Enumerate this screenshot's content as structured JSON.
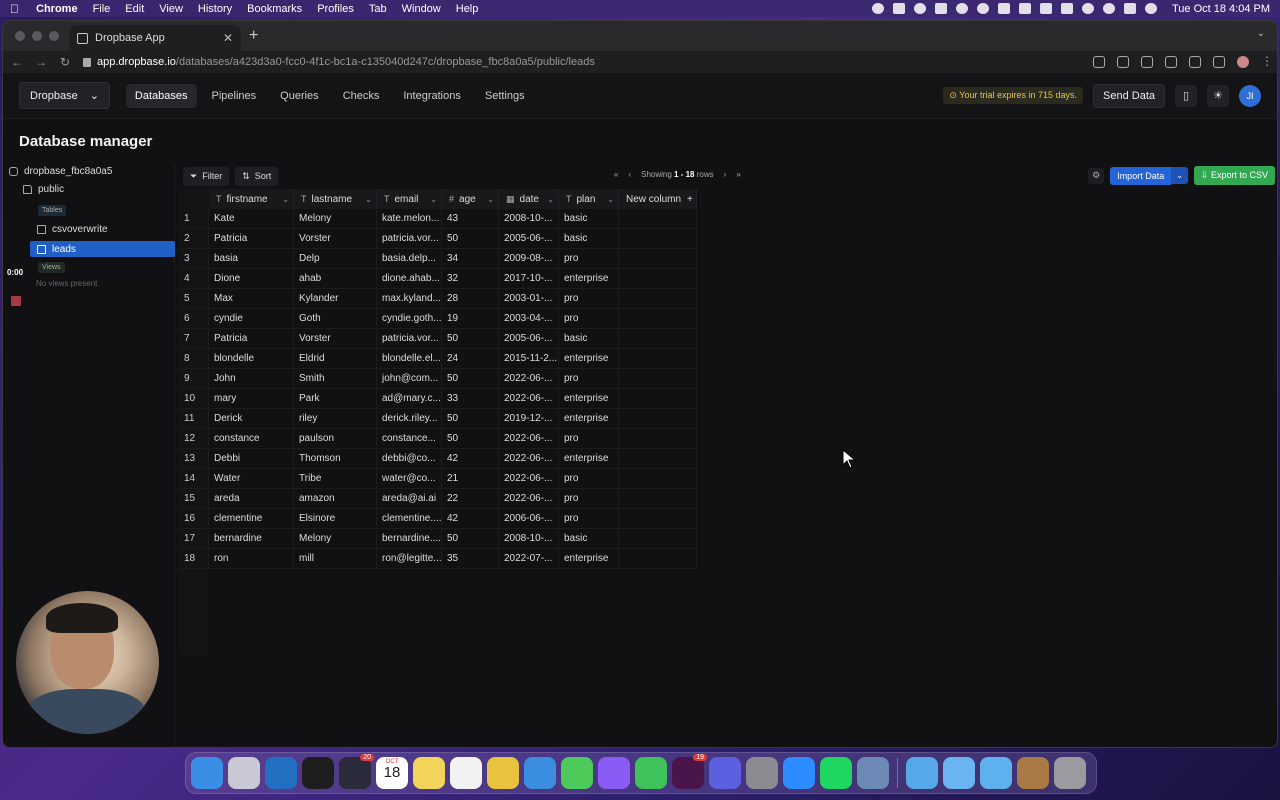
{
  "menubar": {
    "app": "Chrome",
    "items": [
      "File",
      "Edit",
      "View",
      "History",
      "Bookmarks",
      "Profiles",
      "Tab",
      "Window",
      "Help"
    ],
    "clock": "Tue Oct 18  4:04 PM"
  },
  "browser": {
    "tab_title": "Dropbase App",
    "url_host": "app.dropbase.io",
    "url_path": "/databases/a423d3a0-fcc0-4f1c-bc1a-c135040d247c/dropbase_fbc8a0a5/public/leads"
  },
  "appnav": {
    "brand": "Dropbase",
    "links": [
      "Databases",
      "Pipelines",
      "Queries",
      "Checks",
      "Integrations",
      "Settings"
    ],
    "active": "Databases",
    "trial": "Your trial expires in 715 days.",
    "send_data": "Send Data",
    "user_initials": "JI"
  },
  "page_title": "Database manager",
  "sidebar": {
    "database": "dropbase_fbc8a0a5",
    "schema": "public",
    "tables_label": "Tables",
    "tables": [
      "csvoverwrite",
      "leads"
    ],
    "selected_table": "leads",
    "views_label": "Views",
    "no_views": "No views present",
    "timer": "0:00"
  },
  "toolbar": {
    "filter": "Filter",
    "sort": "Sort",
    "showing_prefix": "Showing",
    "showing_range": "1 - 18",
    "showing_suffix": "rows",
    "import": "Import Data",
    "export": "Export to CSV"
  },
  "table": {
    "columns": [
      {
        "name": "firstname",
        "type": "T"
      },
      {
        "name": "lastname",
        "type": "T"
      },
      {
        "name": "email",
        "type": "T"
      },
      {
        "name": "age",
        "type": "#"
      },
      {
        "name": "date",
        "type": "▦"
      },
      {
        "name": "plan",
        "type": "T"
      }
    ],
    "new_column": "New column",
    "rows": [
      [
        "1",
        "Kate",
        "Melony",
        "kate.melon...",
        "43",
        "2008-10-...",
        "basic"
      ],
      [
        "2",
        "Patricia",
        "Vorster",
        "patricia.vor...",
        "50",
        "2005-06-...",
        "basic"
      ],
      [
        "3",
        "basia",
        "Delp",
        "basia.delp...",
        "34",
        "2009-08-...",
        "pro"
      ],
      [
        "4",
        "Dione",
        "ahab",
        "dione.ahab...",
        "32",
        "2017-10-...",
        "enterprise"
      ],
      [
        "5",
        "Max",
        "Kylander",
        "max.kyland...",
        "28",
        "2003-01-...",
        "pro"
      ],
      [
        "6",
        "cyndie",
        "Goth",
        "cyndie.goth...",
        "19",
        "2003-04-...",
        "pro"
      ],
      [
        "7",
        "Patricia",
        "Vorster",
        "patricia.vor...",
        "50",
        "2005-06-...",
        "basic"
      ],
      [
        "8",
        "blondelle",
        "Eldrid",
        "blondelle.el...",
        "24",
        "2015-11-2...",
        "enterprise"
      ],
      [
        "9",
        "John",
        "Smith",
        "john@com...",
        "50",
        "2022-06-...",
        "pro"
      ],
      [
        "10",
        "mary",
        "Park",
        "ad@mary.c...",
        "33",
        "2022-06-...",
        "enterprise"
      ],
      [
        "11",
        "Derick",
        "riley",
        "derick.riley...",
        "50",
        "2019-12-...",
        "enterprise"
      ],
      [
        "12",
        "constance",
        "paulson",
        "constance...",
        "50",
        "2022-06-...",
        "pro"
      ],
      [
        "13",
        "Debbi",
        "Thomson",
        "debbi@co...",
        "42",
        "2022-06-...",
        "enterprise"
      ],
      [
        "14",
        "Water",
        "Tribe",
        "water@co...",
        "21",
        "2022-06-...",
        "pro"
      ],
      [
        "15",
        "areda",
        "amazon",
        "areda@ai.ai",
        "22",
        "2022-06-...",
        "pro"
      ],
      [
        "16",
        "clementine",
        "Elsinore",
        "clementine....",
        "42",
        "2006-06-...",
        "pro"
      ],
      [
        "17",
        "bernardine",
        "Melony",
        "bernardine....",
        "50",
        "2008-10-...",
        "basic"
      ],
      [
        "18",
        "ron",
        "mill",
        "ron@legitte...",
        "35",
        "2022-07-...",
        "enterprise"
      ]
    ]
  },
  "dock": {
    "apps": [
      {
        "name": "finder-icon",
        "color": "#3a8ee6"
      },
      {
        "name": "launchpad-icon",
        "color": "#c9c9d6"
      },
      {
        "name": "vscode-icon",
        "color": "#2370c2"
      },
      {
        "name": "figma-icon",
        "color": "#1e1e1e"
      },
      {
        "name": "stack-icon",
        "color": "#2a2a3a",
        "badge": "20"
      },
      {
        "name": "calendar-icon",
        "calendar": true,
        "month": "OCT",
        "day": "18"
      },
      {
        "name": "notes-icon",
        "color": "#f3d45a"
      },
      {
        "name": "reminders-icon",
        "color": "#f2f2f2"
      },
      {
        "name": "chrome-icon",
        "color": "#e9c33d"
      },
      {
        "name": "safari-icon",
        "color": "#3b8de0"
      },
      {
        "name": "messages-icon",
        "color": "#4ccb5a"
      },
      {
        "name": "messenger-icon",
        "color": "#8a5cf5"
      },
      {
        "name": "whatsapp-icon",
        "color": "#3ec35a"
      },
      {
        "name": "slack-icon",
        "color": "#4a154b",
        "badge": "19"
      },
      {
        "name": "linear-icon",
        "color": "#5b5fe0"
      },
      {
        "name": "system-settings-icon",
        "color": "#8a8a90"
      },
      {
        "name": "zoom-icon",
        "color": "#2d8cff"
      },
      {
        "name": "spotify-icon",
        "color": "#1ed760"
      },
      {
        "name": "preview-icon",
        "color": "#6c8ab5"
      },
      {
        "name": "folder-icon",
        "color": "#57a8e8",
        "sep_before": true
      },
      {
        "name": "documents-icon",
        "color": "#6ab4f0"
      },
      {
        "name": "downloads-icon",
        "color": "#5fb0ee"
      },
      {
        "name": "archive-icon",
        "color": "#a97a45"
      },
      {
        "name": "trash-icon",
        "color": "#9a9aa0"
      }
    ]
  }
}
